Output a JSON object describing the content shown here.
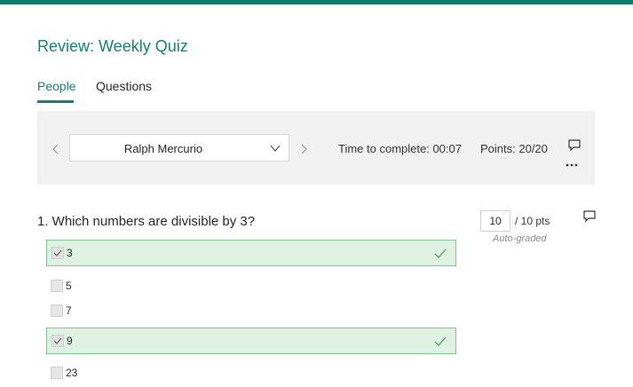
{
  "form": {
    "title": "Review: Weekly Quiz"
  },
  "tabs": [
    {
      "label": "People",
      "active": true
    },
    {
      "label": "Questions",
      "active": false
    }
  ],
  "nav": {
    "respondent": "Ralph Mercurio",
    "time_to_complete": "Time to complete: 00:07",
    "points": "Points: 20/20",
    "prev_icon": "chevron-left-icon",
    "next_icon": "chevron-right-icon",
    "dropdown_icon": "chevron-down-icon",
    "comment_icon": "comment-icon",
    "more_icon": "more-icon"
  },
  "question": {
    "text": "1. Which numbers are divisible by 3?",
    "score_value": "10",
    "score_total": "/ 10 pts",
    "grading": "Auto-graded",
    "options": [
      {
        "label": "3",
        "checked": true,
        "correct": true
      },
      {
        "label": "5",
        "checked": false,
        "correct": false
      },
      {
        "label": "7",
        "checked": false,
        "correct": false
      },
      {
        "label": "9",
        "checked": true,
        "correct": true
      },
      {
        "label": "23",
        "checked": false,
        "correct": false
      }
    ]
  },
  "colors": {
    "accent": "#1a7b6f",
    "correct_bg": "#dff1e2",
    "correct_border": "#80c48e",
    "panel_bg": "#f1f1f1"
  }
}
